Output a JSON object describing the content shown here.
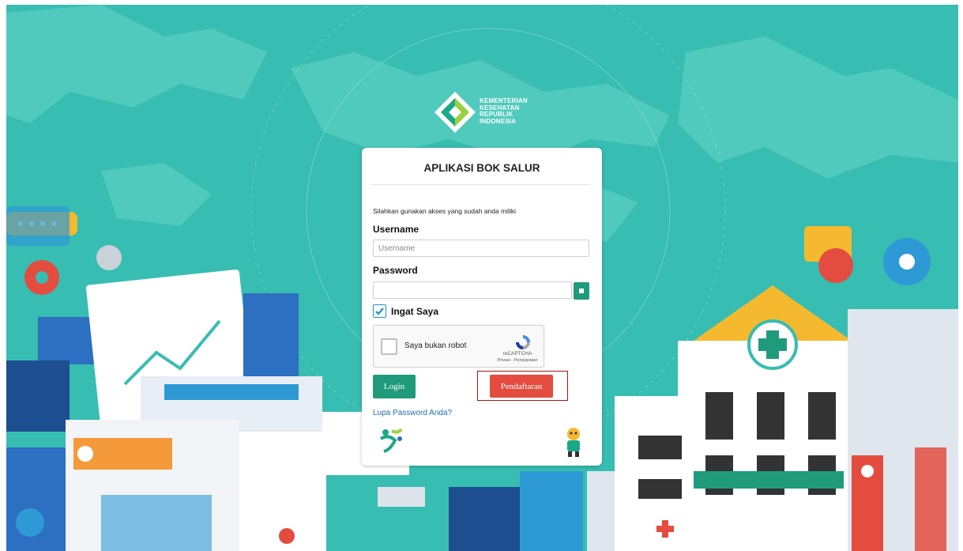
{
  "ministry": {
    "logo_lines": [
      "KEMENTERIAN",
      "KESEHATAN",
      "REPUBLIK",
      "INDONESIA"
    ]
  },
  "login": {
    "title": "APLIKASI BOK SALUR",
    "intro": "Silahkan gunakan akses yang sudah anda miliki",
    "username_label": "Username",
    "username_placeholder": "Username",
    "username_value": "",
    "password_label": "Password",
    "password_value": "",
    "remember_label": "Ingat Saya",
    "remember_checked": true,
    "captcha_label": "Saya bukan robot",
    "captcha_brand": "reCAPTCHA",
    "captcha_links": "Privasi - Persyaratan",
    "login_button": "Login",
    "register_button": "Pendaftaran",
    "forgot_link": "Lupa Password Anda?"
  },
  "colors": {
    "background": "#37bdb1",
    "primary_button": "#1f9b7b",
    "register_button": "#e34c3f",
    "highlight_border": "#a31515",
    "link": "#1f6fb2"
  },
  "icons": [
    "kemenkes-logo",
    "eye-toggle-icon",
    "checkbox-check-icon",
    "recaptcha-icon",
    "germas-icon",
    "mascot-icon"
  ]
}
